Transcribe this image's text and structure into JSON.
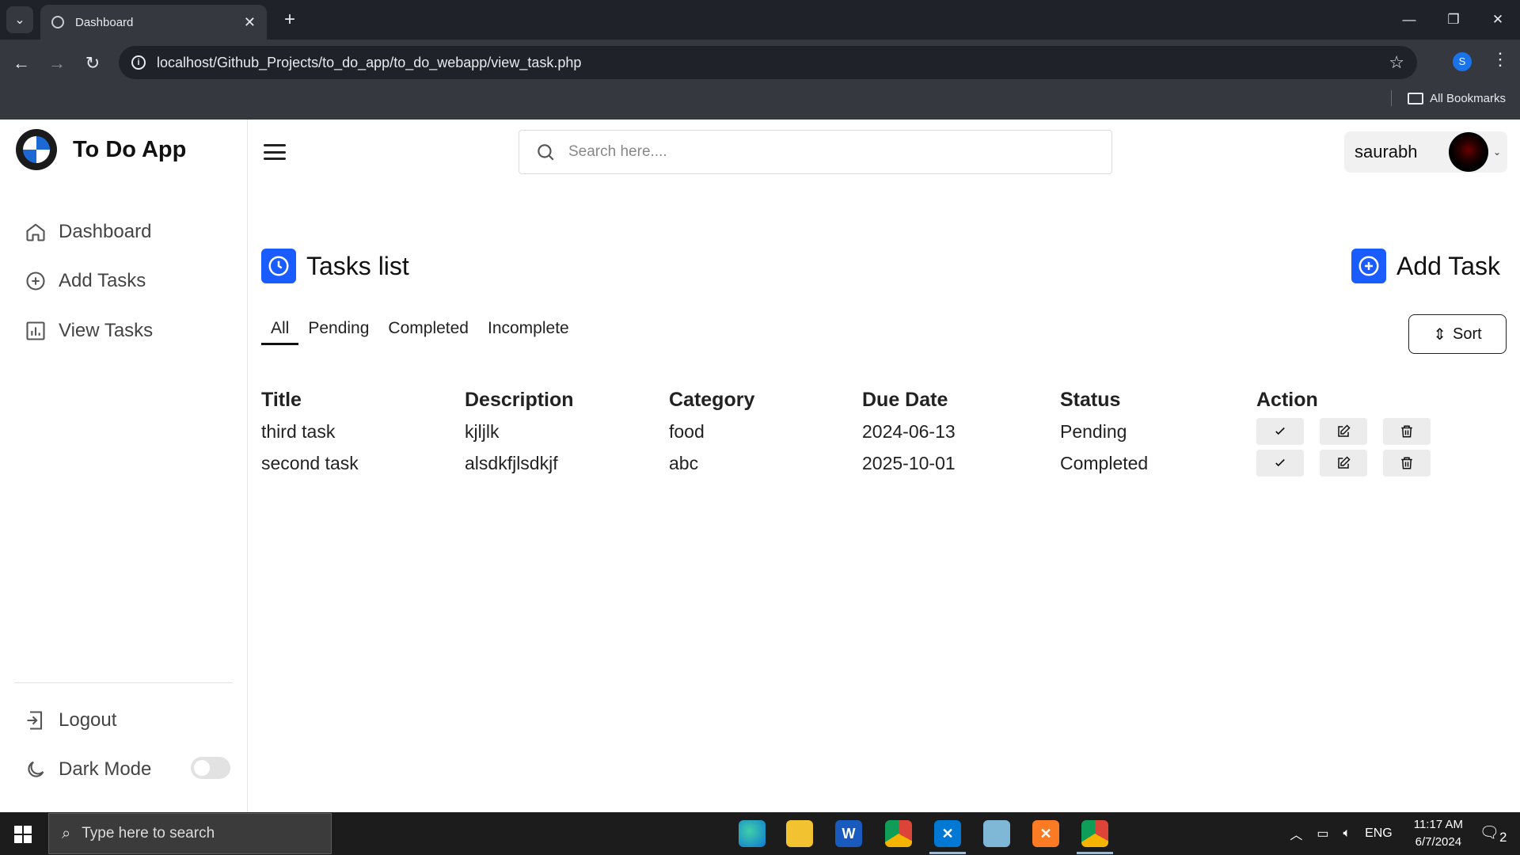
{
  "browser": {
    "tab_title": "Dashboard",
    "url": "localhost/Github_Projects/to_do_app/to_do_webapp/view_task.php",
    "profile_initial": "S",
    "bookmarks_label": "All Bookmarks"
  },
  "app": {
    "brand": "To Do App",
    "sidebar": {
      "items": [
        {
          "label": "Dashboard",
          "icon": "home-icon"
        },
        {
          "label": "Add Tasks",
          "icon": "plus-circle-icon"
        },
        {
          "label": "View Tasks",
          "icon": "bar-chart-icon"
        }
      ],
      "logout_label": "Logout",
      "dark_mode_label": "Dark Mode",
      "dark_mode_on": false
    },
    "search_placeholder": "Search here....",
    "user_name": "saurabh",
    "page_title": "Tasks list",
    "add_task_label": "Add Task",
    "filter_tabs": [
      "All",
      "Pending",
      "Completed",
      "Incomplete"
    ],
    "active_tab": "All",
    "sort_label": "Sort",
    "table": {
      "headers": [
        "Title",
        "Description",
        "Category",
        "Due Date",
        "Status",
        "Action"
      ],
      "rows": [
        {
          "title": "third task",
          "description": "kjljlk",
          "category": "food",
          "due_date": "2024-06-13",
          "status": "Pending"
        },
        {
          "title": "second task",
          "description": "alsdkfjlsdkjf",
          "category": "abc",
          "due_date": "2025-10-01",
          "status": "Completed"
        }
      ]
    },
    "accent_color": "#1a5cff"
  },
  "taskbar": {
    "search_placeholder": "Type here to search",
    "language": "ENG",
    "time": "11:17 AM",
    "date": "6/7/2024",
    "notifications": "2"
  }
}
